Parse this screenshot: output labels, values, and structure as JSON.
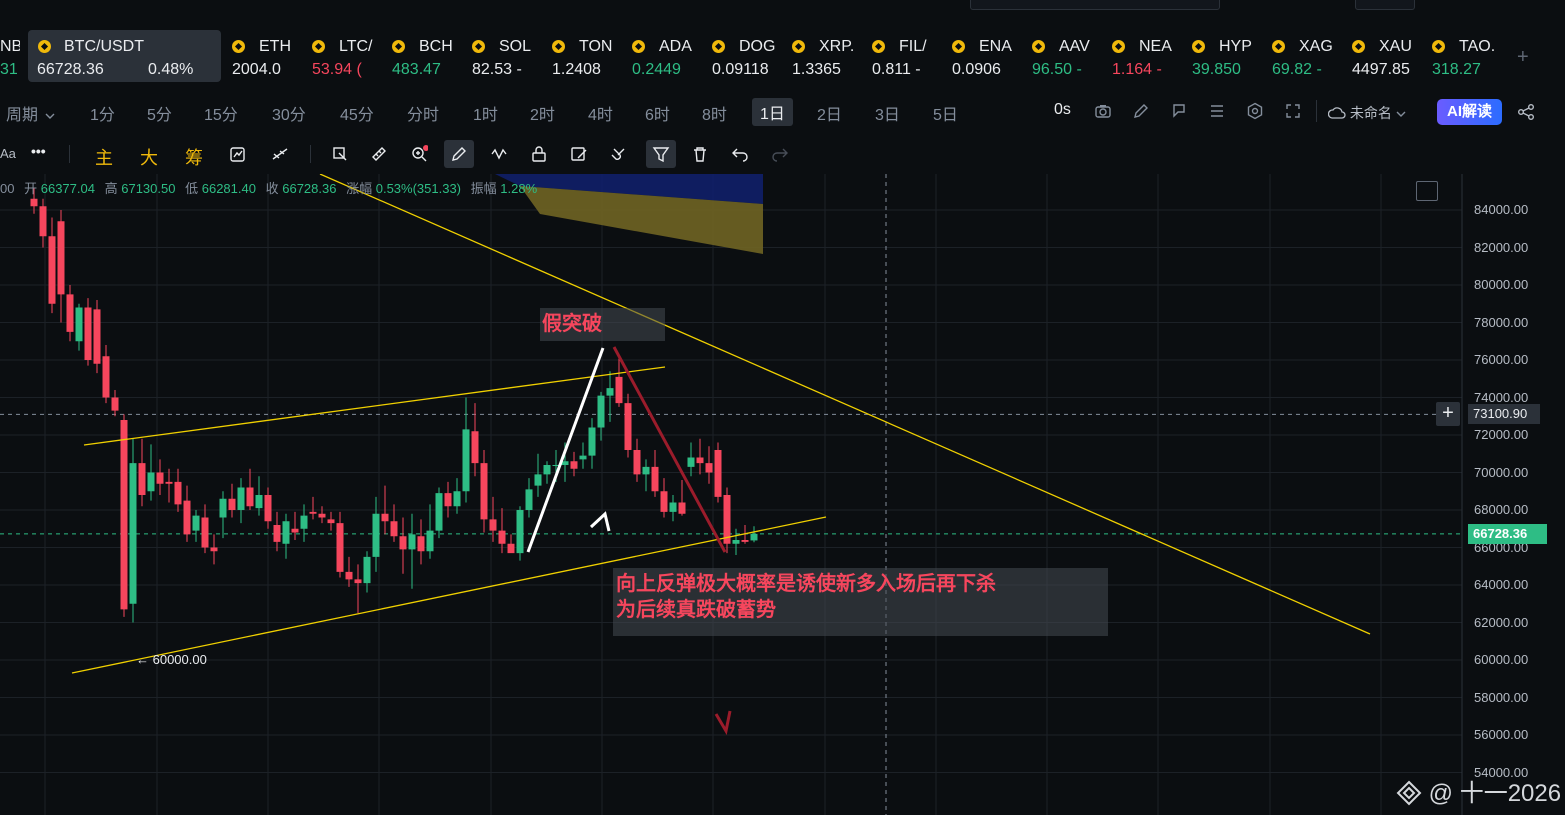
{
  "ticker": {
    "active": {
      "symbol": "BTC/USDT",
      "price": "66728.36",
      "change": "0.48%"
    },
    "partial_left": {
      "symbol": "NB",
      "price": "31"
    },
    "items": [
      {
        "symbol": "ETH",
        "price": "2004.0",
        "dir": "wh"
      },
      {
        "symbol": "LTC/",
        "price": "53.94 (",
        "dir": "dn"
      },
      {
        "symbol": "BCH",
        "price": "483.47",
        "dir": "up"
      },
      {
        "symbol": "SOL",
        "price": "82.53 -",
        "dir": "wh"
      },
      {
        "symbol": "TON",
        "price": "1.2408",
        "dir": "wh"
      },
      {
        "symbol": "ADA",
        "price": "0.2449",
        "dir": "up"
      },
      {
        "symbol": "DOG",
        "price": "0.09118",
        "dir": "wh"
      },
      {
        "symbol": "XRP.",
        "price": "1.3365",
        "dir": "wh"
      },
      {
        "symbol": "FIL/",
        "price": "0.811 -",
        "dir": "wh"
      },
      {
        "symbol": "ENA",
        "price": "0.0906",
        "dir": "wh"
      },
      {
        "symbol": "AAV",
        "price": "96.50 -",
        "dir": "up"
      },
      {
        "symbol": "NEA",
        "price": "1.164 -",
        "dir": "dn"
      },
      {
        "symbol": "HYP",
        "price": "39.850",
        "dir": "up"
      },
      {
        "symbol": "XAG",
        "price": "69.82 -",
        "dir": "up"
      },
      {
        "symbol": "XAU",
        "price": "4497.85",
        "dir": "wh"
      },
      {
        "symbol": "TAO.",
        "price": "318.27",
        "dir": "up"
      }
    ],
    "add": "+"
  },
  "timeframes": {
    "period_label": "周期",
    "items": [
      "1分",
      "5分",
      "15分",
      "30分",
      "45分",
      "分时",
      "1时",
      "2时",
      "4时",
      "6时",
      "8时",
      "1日",
      "2日",
      "3日",
      "5日"
    ],
    "selected": "1日",
    "delay": "0s",
    "layout_name": "未命名",
    "ai_button": "AI解读"
  },
  "toolbar": {
    "aa": "Aa",
    "more": "•••",
    "main": "主",
    "big": "大",
    "chips": "筹"
  },
  "ohlc": {
    "prefix": "00",
    "open_label": "开",
    "open": "66377.04",
    "high_label": "高",
    "high": "67130.50",
    "low_label": "低",
    "low": "66281.40",
    "close_label": "收",
    "close": "66728.36",
    "change_label": "涨幅",
    "change": "0.53%(351.33)",
    "amp_label": "振幅",
    "amp": "1.28%"
  },
  "chart_data": {
    "type": "candlestick",
    "symbol": "BTC/USDT",
    "interval": "1日",
    "y_ticks": [
      84000,
      82000,
      80000,
      78000,
      76000,
      74000,
      72000,
      70000,
      68000,
      66000,
      64000,
      62000,
      60000,
      58000,
      56000,
      54000
    ],
    "ylim": [
      53500,
      85000
    ],
    "last_price": 66728.36,
    "crosshair_price": 73100.9,
    "low_marker": 60000.0,
    "low_marker_text": "← 60000.00",
    "candles": [
      [
        84600,
        85200,
        83800,
        84200
      ],
      [
        84200,
        84600,
        82000,
        82600
      ],
      [
        82600,
        83600,
        78500,
        79000
      ],
      [
        83400,
        84000,
        78000,
        79500
      ],
      [
        79500,
        80000,
        77000,
        77500
      ],
      [
        77000,
        79000,
        76500,
        78800
      ],
      [
        78800,
        79300,
        75700,
        76000
      ],
      [
        78700,
        79200,
        75300,
        75800
      ],
      [
        76200,
        76800,
        73700,
        74000
      ],
      [
        74000,
        74400,
        73000,
        73300
      ],
      [
        72800,
        73100,
        62300,
        62700
      ],
      [
        63000,
        71800,
        62000,
        70500
      ],
      [
        70500,
        71800,
        68200,
        68800
      ],
      [
        69000,
        71500,
        68500,
        70000
      ],
      [
        70000,
        70700,
        68800,
        69400
      ],
      [
        69500,
        70200,
        68400,
        69400
      ],
      [
        69500,
        70200,
        67900,
        68300
      ],
      [
        68500,
        69300,
        66300,
        66700
      ],
      [
        66900,
        68000,
        66300,
        67700
      ],
      [
        67600,
        68300,
        65700,
        66000
      ],
      [
        66000,
        66700,
        65100,
        65800
      ],
      [
        67600,
        69000,
        66500,
        68600
      ],
      [
        68600,
        69400,
        67600,
        68000
      ],
      [
        68000,
        69700,
        67300,
        69200
      ],
      [
        69200,
        70200,
        68000,
        68200
      ],
      [
        68100,
        69800,
        67700,
        68800
      ],
      [
        68800,
        69200,
        67000,
        67400
      ],
      [
        67200,
        67900,
        65800,
        66300
      ],
      [
        66200,
        67800,
        65400,
        67400
      ],
      [
        67000,
        67900,
        66400,
        66800
      ],
      [
        67000,
        68300,
        66300,
        67700
      ],
      [
        67900,
        68700,
        67500,
        67800
      ],
      [
        67800,
        68200,
        67300,
        67600
      ],
      [
        67500,
        67900,
        66900,
        67300
      ],
      [
        67300,
        67900,
        64400,
        64700
      ],
      [
        64700,
        65500,
        63900,
        64300
      ],
      [
        64300,
        65100,
        62500,
        64100
      ],
      [
        64100,
        65800,
        63600,
        65500
      ],
      [
        65500,
        68700,
        64700,
        67800
      ],
      [
        67800,
        69300,
        66700,
        67400
      ],
      [
        67400,
        68300,
        66300,
        66600
      ],
      [
        66600,
        67600,
        64600,
        65900
      ],
      [
        65900,
        67800,
        63800,
        66700
      ],
      [
        66600,
        67500,
        65100,
        65800
      ],
      [
        65800,
        68300,
        65400,
        66900
      ],
      [
        66900,
        69200,
        66500,
        68900
      ],
      [
        68900,
        69500,
        67600,
        68200
      ],
      [
        68200,
        69700,
        67800,
        69000
      ],
      [
        69000,
        74000,
        68400,
        72300
      ],
      [
        72200,
        73700,
        69800,
        70500
      ],
      [
        70500,
        71200,
        66800,
        67500
      ],
      [
        67500,
        68700,
        66300,
        66900
      ],
      [
        66900,
        68100,
        65700,
        66200
      ],
      [
        66200,
        66700,
        65800,
        65700
      ],
      [
        65700,
        68200,
        65300,
        68000
      ],
      [
        68000,
        69700,
        67600,
        69100
      ],
      [
        69300,
        71000,
        68700,
        69900
      ],
      [
        69900,
        70600,
        69400,
        70400
      ],
      [
        70400,
        71200,
        69500,
        70400
      ],
      [
        70400,
        71600,
        69500,
        70600
      ],
      [
        70600,
        71100,
        69800,
        70200
      ],
      [
        70700,
        71600,
        70200,
        70900
      ],
      [
        70900,
        72900,
        70200,
        72400
      ],
      [
        72400,
        74300,
        71700,
        74100
      ],
      [
        74100,
        75400,
        72700,
        74500
      ],
      [
        75100,
        76100,
        73500,
        73700
      ],
      [
        73700,
        74200,
        70800,
        71200
      ],
      [
        71200,
        71800,
        69500,
        69900
      ],
      [
        69900,
        70700,
        69000,
        70300
      ],
      [
        70300,
        71200,
        68700,
        69000
      ],
      [
        69000,
        69700,
        67600,
        67900
      ],
      [
        67900,
        68800,
        67400,
        68400
      ],
      [
        68400,
        69600,
        67700,
        67800
      ],
      [
        70300,
        71600,
        69800,
        70800
      ],
      [
        70800,
        71800,
        69900,
        70500
      ],
      [
        70500,
        71400,
        69400,
        70000
      ],
      [
        71200,
        71600,
        68400,
        68700
      ],
      [
        68800,
        69200,
        65700,
        66200
      ],
      [
        66200,
        67000,
        65600,
        66400
      ],
      [
        66400,
        67200,
        66200,
        66300
      ],
      [
        66377.04,
        67130.5,
        66281.4,
        66728.36
      ]
    ],
    "annotations": {
      "fake_breakout": "假突破",
      "note_line1": "向上反弹极大概率是诱使新多入场后再下杀",
      "note_line2": "为后续真跌破蓄势"
    }
  },
  "watermark": "@ 十一2026",
  "colors": {
    "up": "#2ebd85",
    "down": "#f6465d",
    "trendline": "#f0d000",
    "accent": "#f0b90b",
    "bg": "#0b0e11"
  }
}
